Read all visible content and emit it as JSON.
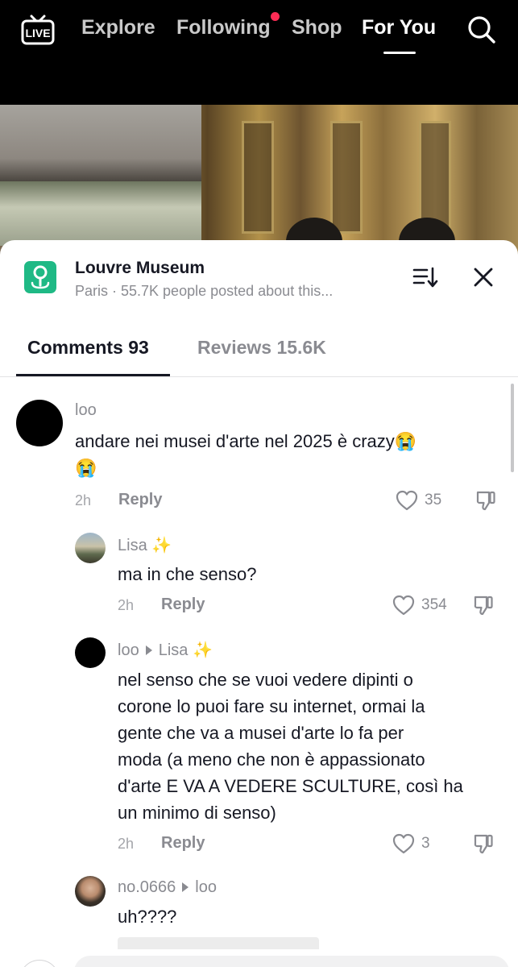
{
  "top_nav": {
    "live_label": "LIVE",
    "tabs": [
      {
        "label": "Explore",
        "active": false
      },
      {
        "label": "Following",
        "active": false,
        "has_dot": true
      },
      {
        "label": "Shop",
        "active": false
      },
      {
        "label": "For You",
        "active": true
      }
    ],
    "search_icon": "search-icon"
  },
  "location": {
    "title": "Louvre Museum",
    "subtitle": "Paris · 55.7K people posted about this...",
    "icon": "map-pin-icon",
    "icon_color": "#1fb985"
  },
  "tabs": [
    {
      "label": "Comments 93",
      "active": true
    },
    {
      "label": "Reviews 15.6K",
      "active": false
    }
  ],
  "comments": [
    {
      "username": "loo",
      "text_line1": "andare nei musei d'arte nel 2025 è crazy😭",
      "text_line2": "😭",
      "time": "2h",
      "reply_label": "Reply",
      "likes": "35"
    },
    {
      "username": "Lisa",
      "badge": "✨",
      "text": "ma in che senso?",
      "time": "2h",
      "reply_label": "Reply",
      "likes": "354"
    },
    {
      "username": "loo",
      "reply_to": "Lisa",
      "badge": "✨",
      "text_lines": [
        "nel senso che se vuoi vedere dipinti o",
        "corone lo puoi fare su internet, ormai la",
        "gente che va a musei d'arte lo fa per",
        "moda (a meno che non è appassionato",
        "d'arte E VA A VEDERE SCULTURE, così ha",
        "un minimo di senso)"
      ],
      "time": "2h",
      "reply_label": "Reply",
      "likes": "3"
    },
    {
      "username": "no.0666",
      "reply_to": "loo",
      "text": "uh????"
    }
  ],
  "colors": {
    "accent_red": "#fe2c55",
    "text_primary": "#161823",
    "text_secondary": "#8a8b91"
  }
}
